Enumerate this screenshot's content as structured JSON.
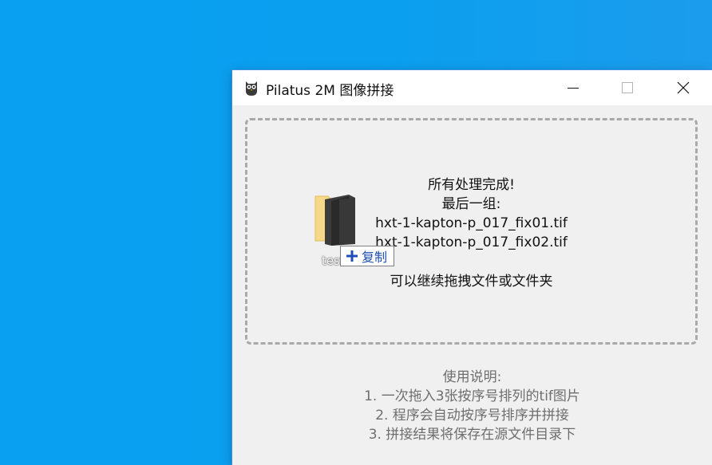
{
  "window": {
    "title": "Pilatus 2M 图像拼接",
    "icon": "owl-icon",
    "controls": {
      "minimize": "minimize-icon",
      "maximize": "maximize-icon",
      "close": "close-icon"
    }
  },
  "drop_zone": {
    "status_line_1": "所有处理完成!",
    "status_line_2": "最后一组:",
    "file_1": "hxt-1-kapton-p_017_fix01.tif",
    "file_2": "hxt-1-kapton-p_017_fix02.tif",
    "hint": "可以继续拖拽文件或文件夹"
  },
  "instructions": {
    "title": "使用说明:",
    "step_1": "1. 一次拖入3张按序号排列的tif图片",
    "step_2": "2. 程序会自动按序号排序并拼接",
    "step_3": "3. 拼接结果将保存在源文件目录下"
  },
  "drag_ghost": {
    "icon": "folder-icon",
    "label": "test",
    "action": "复制",
    "action_icon": "plus-icon"
  },
  "colors": {
    "desktop": "#0aa0f2",
    "window_bg": "#f0f0f0",
    "dashed_border": "#a9a9a9",
    "instruction_text": "#6e6e6e",
    "copy_text": "#1f4fb5"
  }
}
